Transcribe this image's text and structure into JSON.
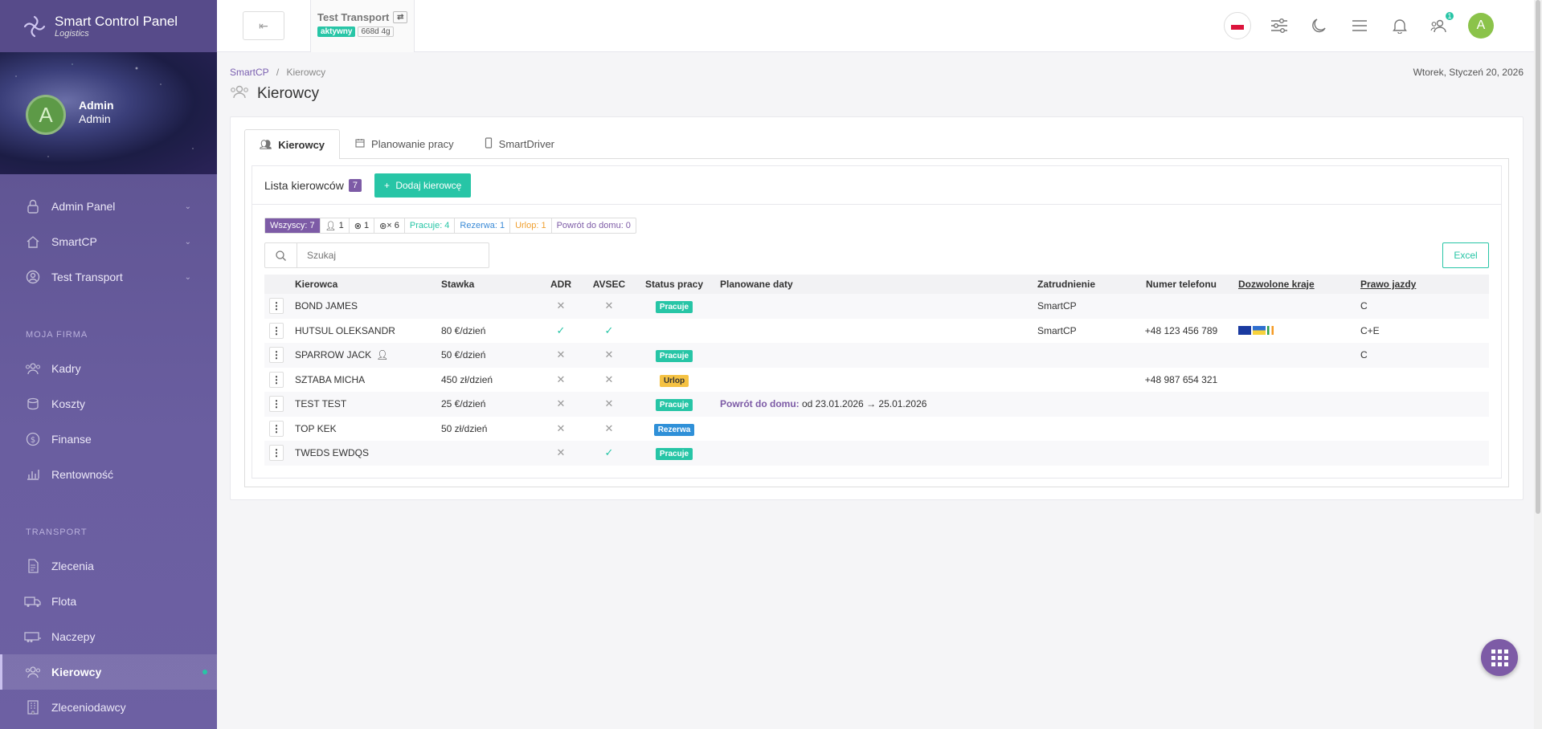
{
  "brand": {
    "title": "Smart Control Panel",
    "subtitle": "Logistics"
  },
  "profile": {
    "initial": "A",
    "name": "Admin",
    "role": "Admin"
  },
  "sidebar": {
    "top_items": [
      {
        "label": "Admin Panel",
        "icon": "lock-icon"
      },
      {
        "label": "SmartCP",
        "icon": "home-icon"
      },
      {
        "label": "Test Transport",
        "icon": "user-circle-icon"
      }
    ],
    "section_company": "MOJA FIRMA",
    "company_items": [
      {
        "label": "Kadry",
        "icon": "users-icon"
      },
      {
        "label": "Koszty",
        "icon": "coins-icon"
      },
      {
        "label": "Finanse",
        "icon": "dollar-icon"
      },
      {
        "label": "Rentowność",
        "icon": "chart-icon"
      }
    ],
    "section_transport": "TRANSPORT",
    "transport_items": [
      {
        "label": "Zlecenia",
        "icon": "document-icon"
      },
      {
        "label": "Flota",
        "icon": "truck-icon"
      },
      {
        "label": "Naczepy",
        "icon": "trailer-icon"
      },
      {
        "label": "Kierowcy",
        "icon": "users-icon",
        "active": true
      },
      {
        "label": "Zleceniodawcy",
        "icon": "building-icon"
      }
    ]
  },
  "header": {
    "back_symbol": "⇤",
    "company_name": "Test Transport",
    "status_badge": "aktywny",
    "days_badge": "668d 4g",
    "notifications_count": "1",
    "user_initial": "A"
  },
  "breadcrumb": {
    "root": "SmartCP",
    "separator": "/",
    "current": "Kierowcy"
  },
  "date": "Wtorek, Styczeń 20, 2026",
  "page_title": "Kierowcy",
  "tabs": [
    {
      "label": "Kierowcy",
      "active": true
    },
    {
      "label": "Planowanie pracy"
    },
    {
      "label": "SmartDriver"
    }
  ],
  "list": {
    "title": "Lista kierowców",
    "count": "7",
    "add_button": "Dodaj kierowcę"
  },
  "filters": {
    "all": "Wszyscy: 7",
    "with_user": "1",
    "blocked": "1",
    "no_app": "× 6",
    "working": "Pracuje: 4",
    "reserve": "Rezerwa: 1",
    "leave": "Urlop: 1",
    "home": "Powrót do domu: 0"
  },
  "search": {
    "placeholder": "Szukaj"
  },
  "excel_button": "Excel",
  "table": {
    "columns": [
      "Kierowca",
      "Stawka",
      "ADR",
      "AVSEC",
      "Status pracy",
      "Planowane daty",
      "Zatrudnienie",
      "Numer telefonu",
      "Dozwolone kraje",
      "Prawo jazdy"
    ],
    "rows": [
      {
        "name": "BOND JAMES",
        "rate": "",
        "adr": "no",
        "avsec": "no",
        "status": "Pracuje",
        "status_type": "pracuje",
        "plan_label": "",
        "plan": "",
        "employment": "SmartCP",
        "phone": "",
        "flags": false,
        "license": "C"
      },
      {
        "name": "HUTSUL OLEKSANDR",
        "rate": "80 €/dzień",
        "adr": "yes",
        "avsec": "yes",
        "status": "",
        "status_type": "",
        "plan_label": "",
        "plan": "",
        "employment": "SmartCP",
        "phone": "+48 123 456 789",
        "flags": true,
        "license": "C+E"
      },
      {
        "name": "SPARROW JACK",
        "rate": "50 €/dzień",
        "adr": "no",
        "avsec": "no",
        "status": "Pracuje",
        "status_type": "pracuje",
        "plan_label": "",
        "plan": "",
        "employment": "",
        "phone": "",
        "flags": false,
        "license": "C",
        "has_user": true
      },
      {
        "name": "SZTABA MICHA",
        "rate": "450 zł/dzień",
        "adr": "no",
        "avsec": "no",
        "status": "Urlop",
        "status_type": "urlop",
        "plan_label": "",
        "plan": "",
        "employment": "",
        "phone": "+48 987 654 321",
        "flags": false,
        "license": ""
      },
      {
        "name": "TEST TEST",
        "rate": "25 €/dzień",
        "adr": "no",
        "avsec": "no",
        "status": "Pracuje",
        "status_type": "pracuje",
        "plan_label": "Powrót do domu:",
        "plan": " od 23.01.2026 → 25.01.2026",
        "employment": "",
        "phone": "",
        "flags": false,
        "license": ""
      },
      {
        "name": "TOP KEK",
        "rate": "50 zł/dzień",
        "adr": "no",
        "avsec": "no",
        "status": "Rezerwa",
        "status_type": "rezerwa",
        "plan_label": "",
        "plan": "",
        "employment": "",
        "phone": "",
        "flags": false,
        "license": ""
      },
      {
        "name": "TWEDS EWDQS",
        "rate": "",
        "adr": "no",
        "avsec": "yes",
        "status": "Pracuje",
        "status_type": "pracuje",
        "plan_label": "",
        "plan": "",
        "employment": "",
        "phone": "",
        "flags": false,
        "license": ""
      }
    ]
  },
  "colors": {
    "accent": "#7d5ba6",
    "teal": "#27c5a6",
    "sidebar": "#5a4f8c"
  }
}
